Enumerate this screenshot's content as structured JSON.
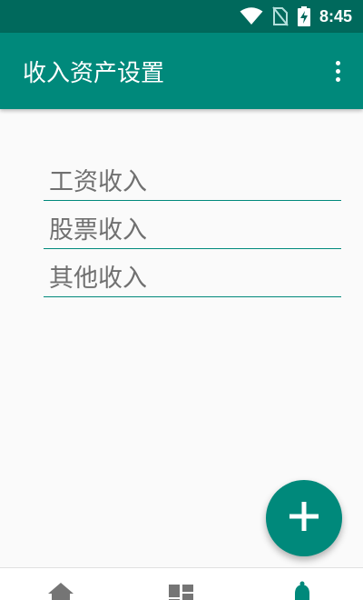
{
  "status_bar": {
    "time": "8:45",
    "icons": [
      "wifi-icon",
      "no-sim-icon",
      "battery-charging-icon"
    ]
  },
  "app_bar": {
    "title": "收入资产设置",
    "menu_icon": "more-vert-icon"
  },
  "income_items": [
    {
      "label": "工资收入"
    },
    {
      "label": "股票收入"
    },
    {
      "label": "其他收入"
    }
  ],
  "fab": {
    "icon": "add-icon"
  },
  "bottom_nav": {
    "items": [
      {
        "icon": "home-icon",
        "active": false
      },
      {
        "icon": "dashboard-icon",
        "active": false
      },
      {
        "icon": "notifications-icon",
        "active": true
      }
    ]
  },
  "colors": {
    "status_bar": "#00695c",
    "primary": "#00897b",
    "text_secondary": "#707070",
    "background": "#fafafa"
  }
}
